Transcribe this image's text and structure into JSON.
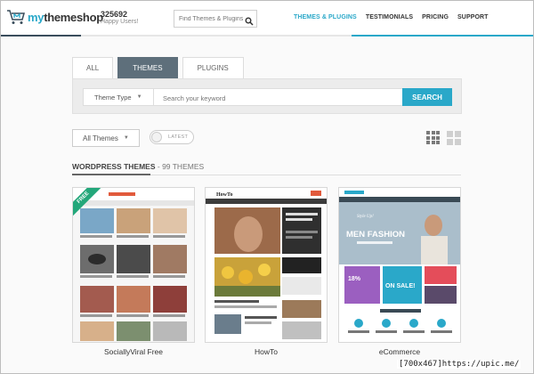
{
  "header": {
    "logo_text_prefix": "my",
    "logo_text_main": "themeshop",
    "count": "325692",
    "count_sub": "Happy Users!",
    "search_placeholder": "Find Themes & Plugins",
    "nav": [
      {
        "label": "THEMES & PLUGINS",
        "active": true
      },
      {
        "label": "TESTIMONIALS",
        "active": false
      },
      {
        "label": "PRICING",
        "active": false
      },
      {
        "label": "SUPPORT",
        "active": false
      }
    ]
  },
  "tabs": [
    {
      "label": "ALL",
      "active": false
    },
    {
      "label": "THEMES",
      "active": true
    },
    {
      "label": "PLUGINS",
      "active": false
    }
  ],
  "search": {
    "type_label": "Theme Type",
    "keyword_placeholder": "Search your keyword",
    "button": "SEARCH"
  },
  "filters": {
    "all_select": "All Themes",
    "toggle_label": "LATEST"
  },
  "section": {
    "title": "WORDPRESS THEMES",
    "count": " - 99 THEMES"
  },
  "themes": [
    {
      "name": "SociallyViral Free",
      "badge": "FREE"
    },
    {
      "name": "HowTo",
      "badge": ""
    },
    {
      "name": "eCommerce",
      "badge": ""
    }
  ],
  "thumb_text": {
    "ecommerce_hero": "MEN FASHION",
    "ecommerce_tag": "Style Up!",
    "ecommerce_sale": "ON SALE!",
    "ecommerce_pct": "18%",
    "howto_logo": "HowTo"
  },
  "watermark": "[700x467]https://upic.me/",
  "colors": {
    "accent": "#2aa8c9",
    "tab_active": "#5e6f7b",
    "free_ribbon": "#23a77a"
  }
}
